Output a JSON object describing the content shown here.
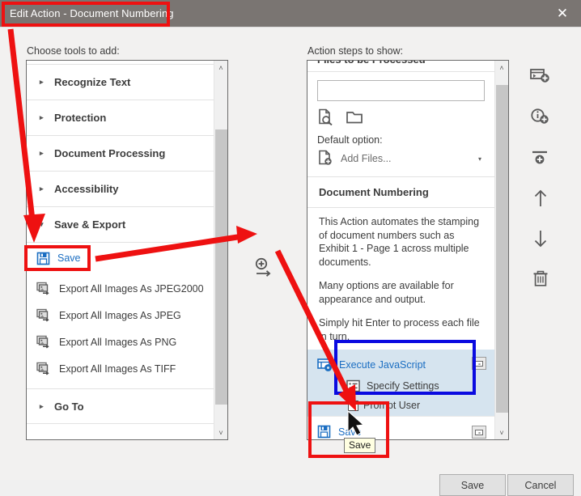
{
  "window": {
    "title": "Edit Action - Document Numbering",
    "close_label": "✕"
  },
  "left": {
    "label": "Choose tools to add:",
    "categories": [
      {
        "label": "Recognize Text",
        "caret": "▸",
        "expanded": false
      },
      {
        "label": "Protection",
        "caret": "▸",
        "expanded": false
      },
      {
        "label": "Document Processing",
        "caret": "▸",
        "expanded": false
      },
      {
        "label": "Accessibility",
        "caret": "▸",
        "expanded": false
      },
      {
        "label": "Save & Export",
        "caret": "▾",
        "expanded": true
      }
    ],
    "tools": [
      {
        "label": "Save",
        "icon": "save-floppy-icon",
        "highlighted": true
      },
      {
        "label": "Export All Images As JPEG2000",
        "icon": "export-images-icon"
      },
      {
        "label": "Export All Images As JPEG",
        "icon": "export-images-icon"
      },
      {
        "label": "Export All Images As PNG",
        "icon": "export-images-icon"
      },
      {
        "label": "Export All Images As TIFF",
        "icon": "export-images-icon"
      }
    ],
    "last_category": {
      "label": "Go To",
      "caret": "▸"
    }
  },
  "right": {
    "label": "Action steps to show:",
    "clipped_header": "Files to be Processed",
    "file_input_value": "",
    "file_icons": [
      "file-search-icon",
      "folder-icon"
    ],
    "default_option_label": "Default option:",
    "default_option_value": "Add Files...",
    "default_option_icon": "add-file-icon",
    "dropdown_arrow": "▾",
    "action_title": "Document Numbering",
    "description": [
      "This Action automates the stamping of document numbers such as Exhibit 1 - Page 1 across multiple documents.",
      "Many options are available for appearance and output.",
      "Simply hit Enter to process each file in turn."
    ],
    "steps": [
      {
        "title": "Execute JavaScript",
        "title_icon": "execute-javascript-icon",
        "sub_label": "Specify Settings",
        "sub_icon": "specify-settings-icon",
        "checkbox_label": "Prompt User",
        "checked": false,
        "selected": true
      },
      {
        "title": "Save",
        "title_icon": "save-floppy-icon",
        "selected": false
      }
    ]
  },
  "middle": {
    "add_step_icon": "add-step-arrow-icon"
  },
  "toolbar": {
    "items": [
      {
        "icon": "add-panel-icon",
        "name": "add-panel-button"
      },
      {
        "icon": "add-instruction-icon",
        "name": "add-instruction-button"
      },
      {
        "icon": "add-divider-icon",
        "name": "add-divider-button"
      },
      {
        "icon": "move-up-arrow-icon",
        "name": "move-up-button"
      },
      {
        "icon": "move-down-arrow-icon",
        "name": "move-down-button"
      },
      {
        "icon": "trash-icon",
        "name": "delete-button"
      }
    ]
  },
  "footer": {
    "save_label": "Save",
    "cancel_label": "Cancel"
  },
  "tooltip": {
    "text": "Save"
  },
  "colors": {
    "titlebar": "#7a7572",
    "accent_blue": "#1b6ec2",
    "selection_blue": "#d6e4ef",
    "annotation_red": "#ee1111",
    "annotation_blue": "#0a0ae0",
    "tooltip_bg": "#ffffe1"
  },
  "scrollbars": {
    "up_arrow": "˄",
    "down_arrow": "˅"
  }
}
